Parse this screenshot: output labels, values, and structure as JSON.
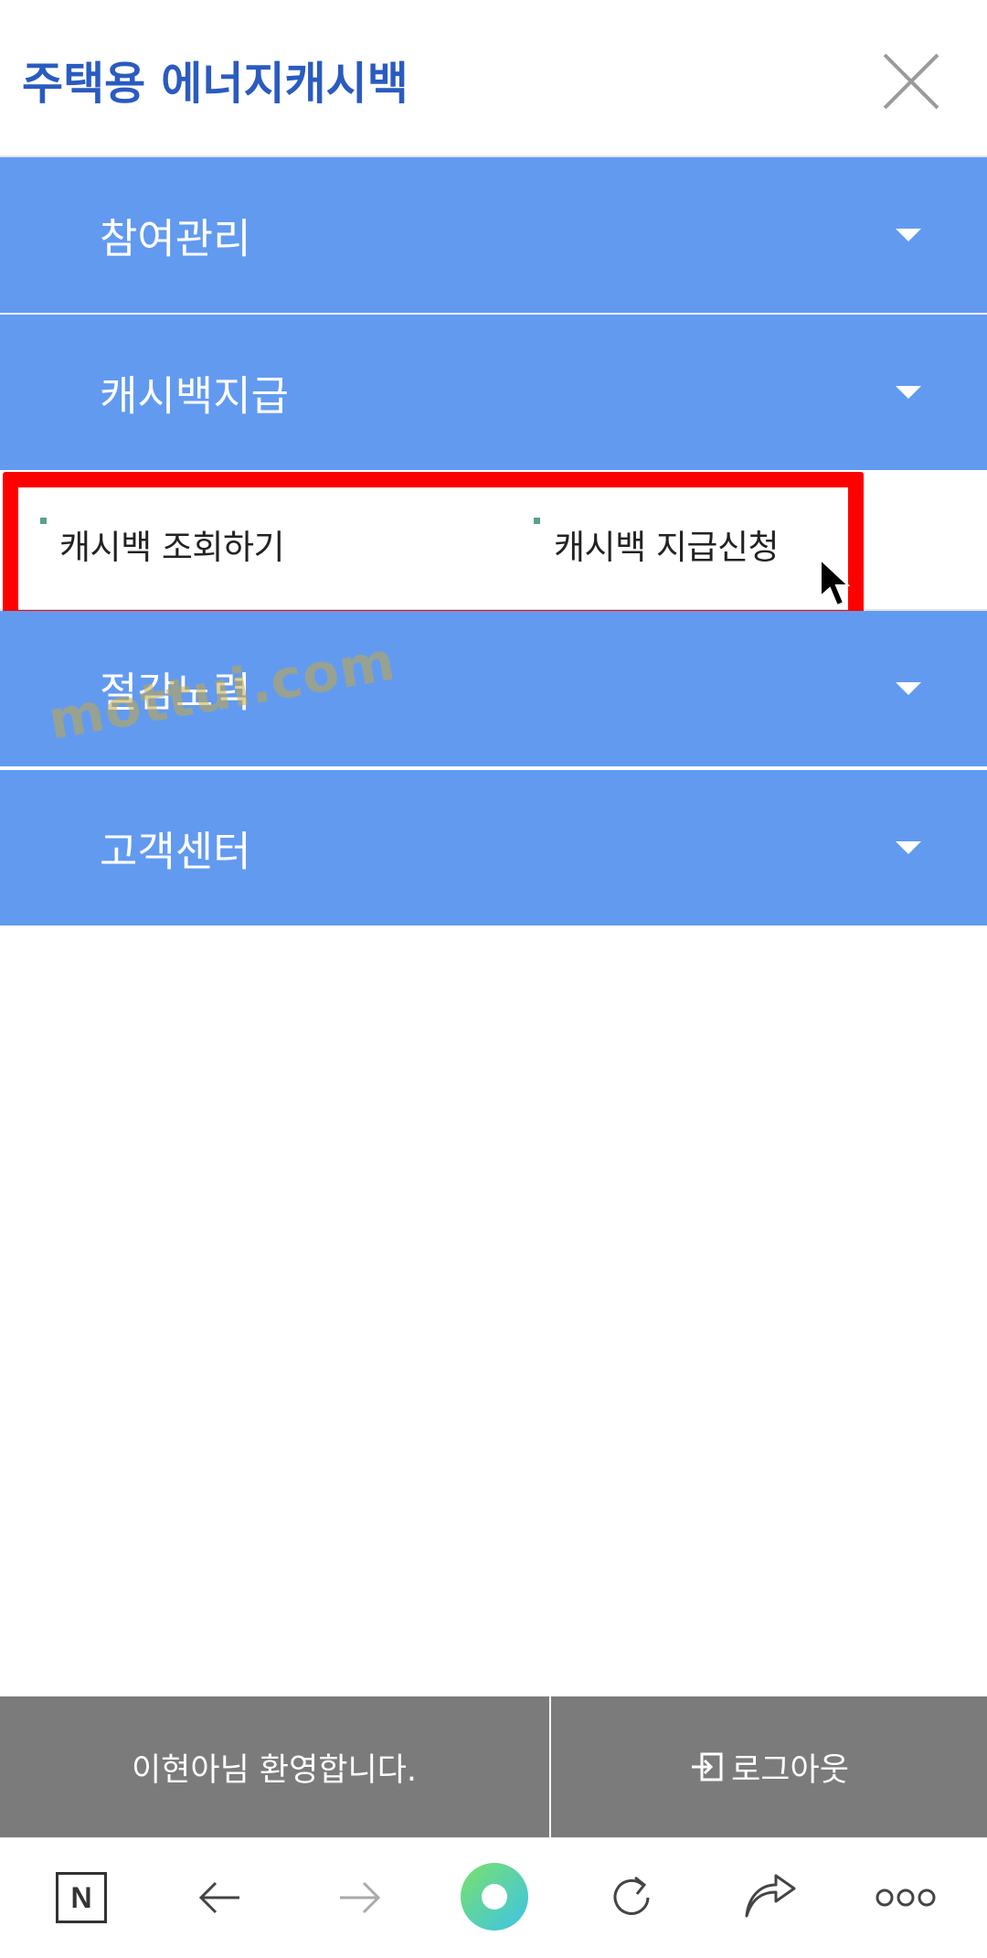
{
  "header": {
    "title": "주택용 에너지캐시백",
    "close_icon": "close-icon"
  },
  "menu": [
    {
      "label": "참여관리",
      "icon": "chevron-down-icon"
    },
    {
      "label": "캐시백지급",
      "icon": "chevron-down-icon",
      "expanded": true,
      "submenu": [
        {
          "label": "캐시백 조회하기"
        },
        {
          "label": "캐시백 지급신청"
        }
      ]
    },
    {
      "label": "절감노력",
      "icon": "chevron-down-icon"
    },
    {
      "label": "고객센터",
      "icon": "chevron-down-icon"
    }
  ],
  "watermark": "mottui.com",
  "footer": {
    "welcome": "이현아님 환영합니다.",
    "logout": "로그아웃",
    "logout_icon": "logout-icon"
  },
  "browser_nav": {
    "icons": [
      "naver-icon",
      "back-icon",
      "forward-icon",
      "home-icon",
      "refresh-icon",
      "share-icon",
      "more-icon"
    ],
    "naver_letter": "N"
  },
  "colors": {
    "menu_bg": "#629af0",
    "brand": "#2a5bc0",
    "highlight": "#ff0000",
    "footer_bg": "#7b7b7b",
    "bullet": "#5aa087"
  }
}
